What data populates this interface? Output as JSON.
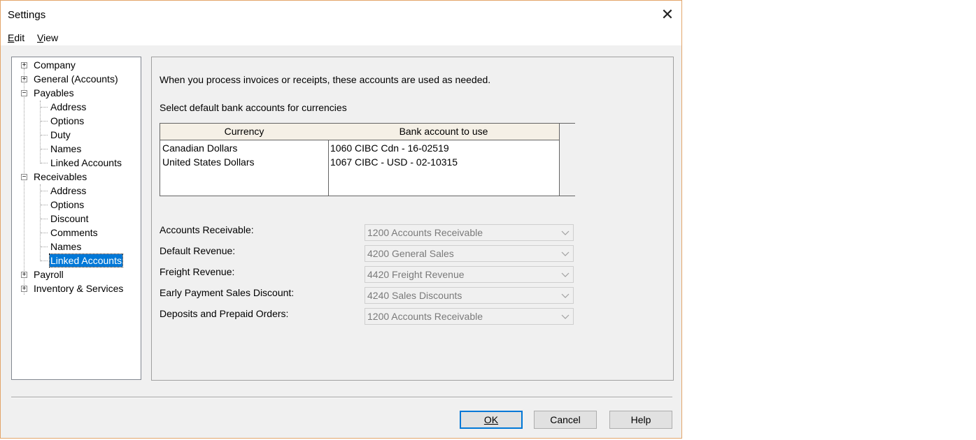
{
  "window": {
    "title": "Settings"
  },
  "menu": {
    "items": [
      "Edit",
      "View"
    ]
  },
  "tree": {
    "items": [
      {
        "label": "Company",
        "level": 0,
        "expander": "+"
      },
      {
        "label": "General (Accounts)",
        "level": 0,
        "expander": "+"
      },
      {
        "label": "Payables",
        "level": 0,
        "expander": "-"
      },
      {
        "label": "Address",
        "level": 1
      },
      {
        "label": "Options",
        "level": 1
      },
      {
        "label": "Duty",
        "level": 1
      },
      {
        "label": "Names",
        "level": 1
      },
      {
        "label": "Linked Accounts",
        "level": 1
      },
      {
        "label": "Receivables",
        "level": 0,
        "expander": "-"
      },
      {
        "label": "Address",
        "level": 1
      },
      {
        "label": "Options",
        "level": 1
      },
      {
        "label": "Discount",
        "level": 1
      },
      {
        "label": "Comments",
        "level": 1
      },
      {
        "label": "Names",
        "level": 1
      },
      {
        "label": "Linked Accounts",
        "level": 1,
        "selected": true
      },
      {
        "label": "Payroll",
        "level": 0,
        "expander": "+"
      },
      {
        "label": "Inventory & Services",
        "level": 0,
        "expander": "+"
      }
    ]
  },
  "panel": {
    "intro": "When you process invoices or receipts, these accounts are used as needed.",
    "bank_prompt": "Select default bank accounts for currencies",
    "grid": {
      "headers": [
        "Currency",
        "Bank account to use"
      ],
      "rows": [
        [
          "Canadian Dollars",
          "1060 CIBC Cdn - 16-02519"
        ],
        [
          "United States Dollars",
          "1067 CIBC - USD - 02-10315"
        ]
      ]
    },
    "fields": [
      {
        "label": "Accounts Receivable:",
        "value": "1200 Accounts Receivable"
      },
      {
        "label": "Default Revenue:",
        "value": "4200 General Sales"
      },
      {
        "label": "Freight Revenue:",
        "value": "4420 Freight Revenue"
      },
      {
        "label": "Early Payment Sales Discount:",
        "value": "4240 Sales Discounts"
      },
      {
        "label": "Deposits and Prepaid Orders:",
        "value": "1200 Accounts Receivable"
      }
    ]
  },
  "buttons": {
    "ok": "OK",
    "cancel": "Cancel",
    "help": "Help"
  },
  "colors": {
    "selection": "#0078d7",
    "grid_header": "#f5f0e6",
    "window_border": "#e3a56a"
  }
}
